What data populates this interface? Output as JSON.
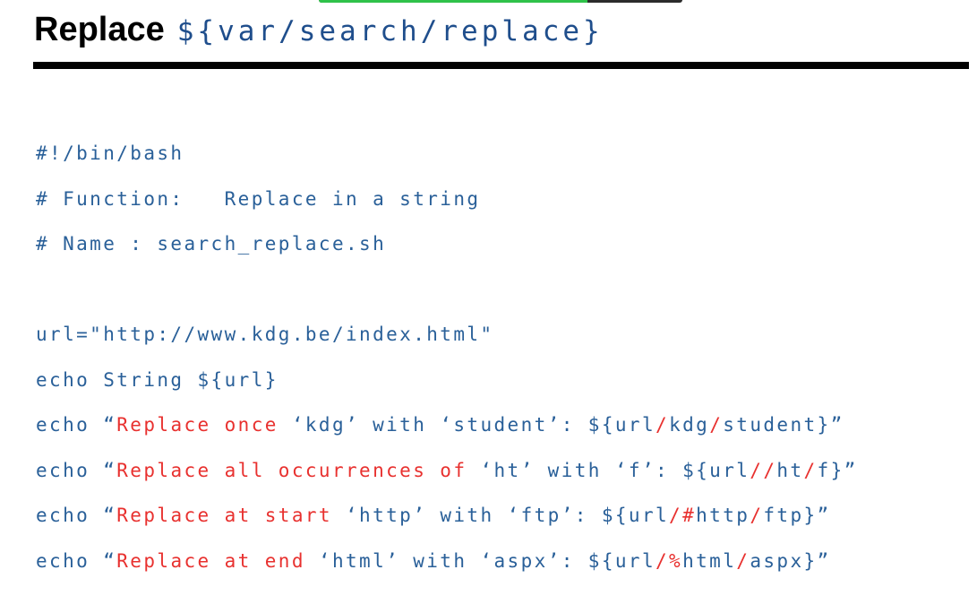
{
  "progress": {
    "fraction": 0.74
  },
  "title": {
    "word": "Replace",
    "code": "${var/search/replace}"
  },
  "colors": {
    "code_blue": "#2a6099",
    "highlight_red": "#e8312f",
    "title_code_blue": "#1f4e8c",
    "progress_green": "#2fc24a"
  },
  "code_lines": [
    [
      {
        "t": "#!/bin/bash"
      }
    ],
    [
      {
        "t": "# Function:   Replace in a string"
      }
    ],
    [
      {
        "t": "# Name : search_replace.sh"
      }
    ],
    [
      {
        "t": ""
      }
    ],
    [
      {
        "t": "url=\"http://www.kdg.be/index.html\""
      }
    ],
    [
      {
        "t": "echo String ${url}"
      }
    ],
    [
      {
        "t": "echo “"
      },
      {
        "t": "Replace once",
        "red": true
      },
      {
        "t": " ‘kdg’ with ‘student’: ${url"
      },
      {
        "t": "/",
        "red": true
      },
      {
        "t": "kdg"
      },
      {
        "t": "/",
        "red": true
      },
      {
        "t": "student}”"
      }
    ],
    [
      {
        "t": "echo “"
      },
      {
        "t": "Replace all occurrences of",
        "red": true
      },
      {
        "t": " ‘ht’ with ‘f’: ${url"
      },
      {
        "t": "//",
        "red": true
      },
      {
        "t": "ht"
      },
      {
        "t": "/",
        "red": true
      },
      {
        "t": "f}”"
      }
    ],
    [
      {
        "t": "echo “"
      },
      {
        "t": "Replace at start",
        "red": true
      },
      {
        "t": " ‘http’ with ‘ftp’: ${url"
      },
      {
        "t": "/#",
        "red": true
      },
      {
        "t": "http"
      },
      {
        "t": "/",
        "red": true
      },
      {
        "t": "ftp}”"
      }
    ],
    [
      {
        "t": "echo “"
      },
      {
        "t": "Replace at end",
        "red": true
      },
      {
        "t": " ‘html’ with ‘aspx’: ${url"
      },
      {
        "t": "/%",
        "red": true
      },
      {
        "t": "html"
      },
      {
        "t": "/",
        "red": true
      },
      {
        "t": "aspx}”"
      }
    ]
  ]
}
